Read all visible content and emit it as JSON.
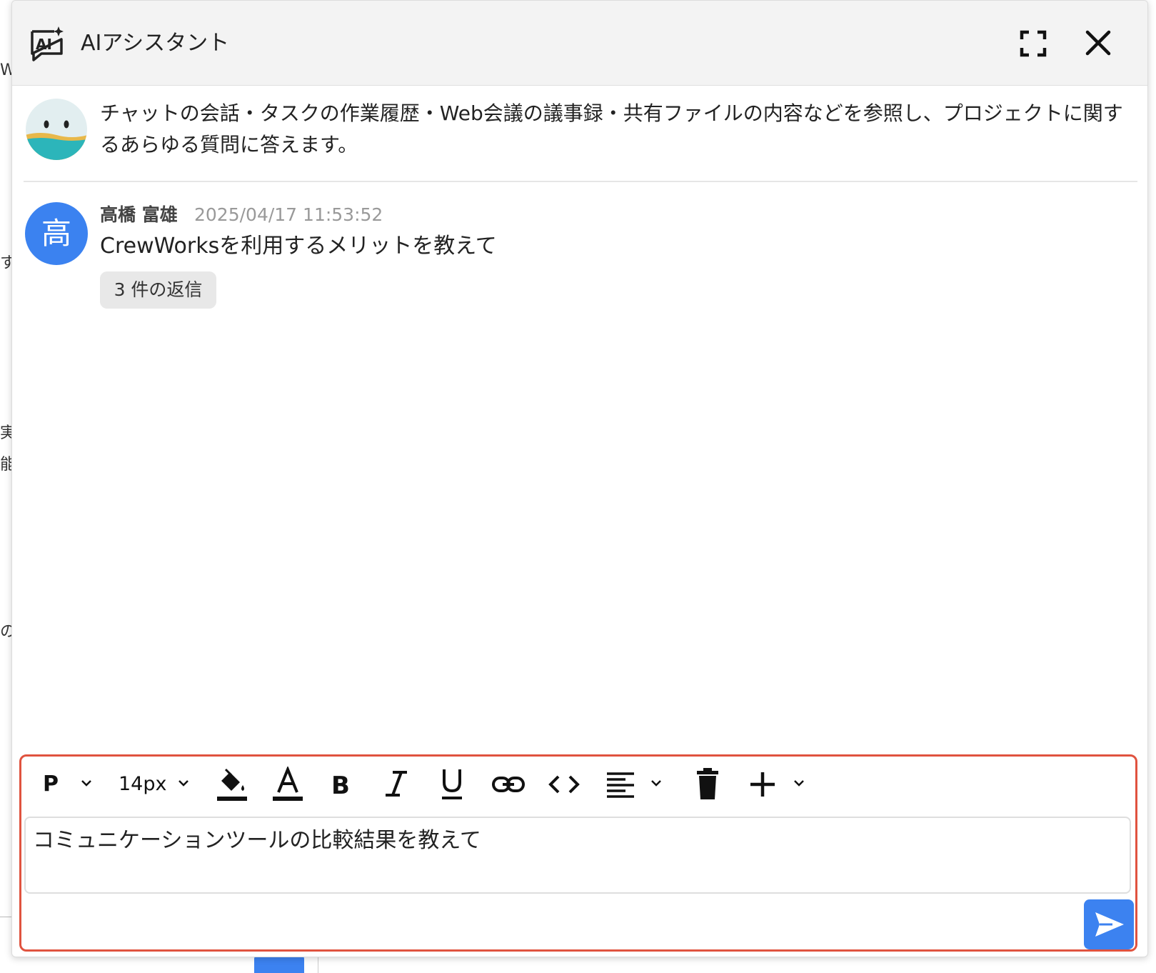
{
  "header": {
    "title": "AIアシスタント",
    "icon": "ai-assistant-icon",
    "actions": [
      {
        "name": "expand",
        "icon": "fullscreen-icon"
      },
      {
        "name": "close",
        "icon": "close-icon"
      }
    ]
  },
  "intro": {
    "avatar": "bot-avatar",
    "text": "チャットの会話・タスクの作業履歴・Web会議の議事録・共有ファイルの内容などを参照し、プロジェクトに関するあらゆる質問に答えます。"
  },
  "messages": [
    {
      "avatar_char": "高",
      "author": "高橋 富雄",
      "timestamp": "2025/04/17 11:53:52",
      "body": "CrewWorksを利用するメリットを教えて",
      "replies_label": "3 件の返信"
    }
  ],
  "composer": {
    "toolbar": {
      "paragraph_label": "P",
      "font_size_label": "14px",
      "items": [
        "paragraph-format",
        "font-size",
        "fill-color",
        "text-color",
        "bold",
        "italic",
        "underline",
        "link",
        "code",
        "align",
        "delete",
        "insert"
      ]
    },
    "input_value": "コミュニケーションツールの比較結果を教えて",
    "send_icon": "send-icon"
  },
  "colors": {
    "accent": "#3c82f0",
    "highlight_border": "#e0533f",
    "header_bg": "#f3f3f3"
  },
  "background": {
    "fragments": [
      "W",
      "す",
      "実",
      "能",
      "の"
    ]
  }
}
